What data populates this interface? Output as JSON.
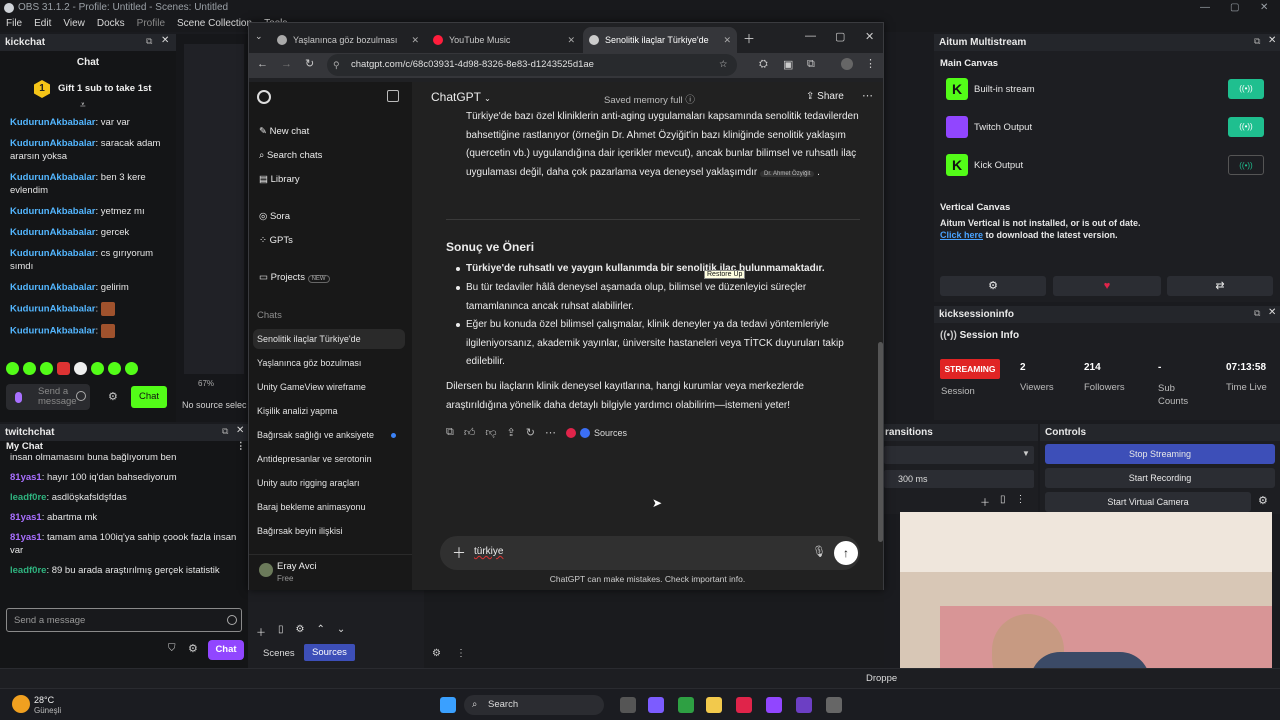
{
  "obs": {
    "title": "OBS 31.1.2 - Profile: Untitled - Scenes: Untitled",
    "menu": [
      "File",
      "Edit",
      "View",
      "Docks",
      "Profile",
      "Scene Collection",
      "Tools"
    ]
  },
  "kickchat": {
    "dock_title": "kickchat",
    "header": "Chat",
    "gift_banner": "Gift 1 sub to take 1st",
    "messages": [
      {
        "user": "KudurunAkbabalar",
        "text": "var var"
      },
      {
        "user": "KudurunAkbabalar",
        "text": "saracak adam ararsın yoksa"
      },
      {
        "user": "KudurunAkbabalar",
        "text": "ben 3 kere evlendim"
      },
      {
        "user": "KudurunAkbabalar",
        "text": "yetmez mı"
      },
      {
        "user": "KudurunAkbabalar",
        "text": "gercek"
      },
      {
        "user": "KudurunAkbabalar",
        "text": "cs gırıyorum sımdı"
      },
      {
        "user": "KudurunAkbabalar",
        "text": "gelirim"
      },
      {
        "user": "KudurunAkbabalar",
        "text": ""
      },
      {
        "user": "KudurunAkbabalar",
        "text": ""
      }
    ],
    "input_placeholder": "Send a message",
    "send_label": "Chat",
    "side_text": "No source selec"
  },
  "browser": {
    "tabs": [
      {
        "label": "Yaşlanınca göz bozulması",
        "icon_color": "#aaaaaa"
      },
      {
        "label": "YouTube Music",
        "icon_color": "#ff1d3c"
      },
      {
        "label": "Senolitik ilaçlar Türkiye'de",
        "icon_color": "#cccccc"
      }
    ],
    "url": "chatgpt.com/c/68c03931-4d98-8326-8e83-d1243525d1ae"
  },
  "chatgpt": {
    "sidebar": {
      "new_chat": "New chat",
      "search": "Search chats",
      "library": "Library",
      "sora": "Sora",
      "gpts": "GPTs",
      "projects": "Projects",
      "projects_badge": "NEW",
      "chats_heading": "Chats",
      "chats": [
        "Senolitik ilaçlar Türkiye'de",
        "Yaşlanınca göz bozulması",
        "Unity GameView wireframe",
        "Kişilik analizi yapma",
        "Bağırsak sağlığı ve anksiyete",
        "Antidepresanlar ve serotonin",
        "Unity auto rigging araçları",
        "Baraj bekleme animasyonu",
        "Bağırsak beyin ilişkisi"
      ],
      "user_name": "Eray Avci",
      "user_plan": "Free"
    },
    "header": {
      "model": "ChatGPT",
      "memory": "Saved memory full",
      "share": "Share"
    },
    "body": {
      "para1": "Türkiye'de bazı özel kliniklerin anti-aging uygulamaları kapsamında senolitik tedavilerden bahsettiğine rastlanıyor (örneğin Dr. Ahmet Özyiğit'in bazı kliniğinde senolitik yaklaşım (quercetin vb.) uygulandığına dair içerikler mevcut), ancak bunlar bilimsel ve ruhsatlı ilaç uygulaması değil, daha çok pazarlama veya deneysel yaklaşımdır",
      "para1_cite": "Dr. Ahmet Özyiğit",
      "heading": "Sonuç ve Öneri",
      "bullets": [
        "Türkiye'de ruhsatlı ve yaygın kullanımda bir senolitik ilaç bulunmamaktadır.",
        "Bu tür tedaviler hâlâ deneysel aşamada olup, bilimsel ve düzenleyici süreçler tamamlanınca ancak ruhsat alabilirler.",
        "Eğer bu konuda özel bilimsel çalışmalar, klinik deneyler ya da tedavi yöntemleriyle ilgileniyorsanız, akademik yayınlar, üniversite hastaneleri veya TİTCK duyuruları takip edilebilir."
      ],
      "tooltip": "Restore Up",
      "closing": "Dilersen bu ilaçların klinik deneysel kayıtlarına, hangi kurumlar veya merkezlerde araştırıldığına yönelik daha detaylı bilgiyle yardımcı olabilirim—istemeni yeter!",
      "sources": "Sources"
    },
    "composer_text": "türkiye",
    "disclaimer": "ChatGPT can make mistakes. Check important info."
  },
  "twitchchat": {
    "dock_title": "twitchchat",
    "header": "My Chat",
    "messages": [
      {
        "user": "",
        "text": "insan olmamasını buna bağlıyorum ben",
        "color": "#e6e6e6"
      },
      {
        "user": "81yas1",
        "text": "hayır 100 iq'dan bahsediyorum",
        "color": "#a970ff"
      },
      {
        "user": "leadf0re",
        "text": "asdlöşkafsldşfdas",
        "color": "#2fb37f"
      },
      {
        "user": "81yas1",
        "text": "abartma mk",
        "color": "#a970ff"
      },
      {
        "user": "81yas1",
        "text": "tamam ama 100iq'ya sahip çoook fazla insan var",
        "color": "#a970ff"
      },
      {
        "user": "leadf0re",
        "text": "89 bu arada araştırılmış gerçek istatistik",
        "color": "#2fb37f"
      }
    ],
    "input_placeholder": "Send a message",
    "chat_button": "Chat"
  },
  "scenes": {
    "tabs": [
      "Scenes",
      "Sources"
    ],
    "transitions_title": "ransitions",
    "duration": "300 ms",
    "zoom": "67%"
  },
  "aitum": {
    "title": "Aitum Multistream",
    "main_canvas": "Main Canvas",
    "outputs": [
      {
        "name": "Built-in stream",
        "logo_color": "#53fc18",
        "active": true
      },
      {
        "name": "Twitch Output",
        "logo_color": "#9146ff",
        "active": true
      },
      {
        "name": "Kick Output",
        "logo_color": "#53fc18",
        "active": false
      }
    ],
    "vertical_canvas": "Vertical Canvas",
    "vertical_warning": "Aitum Vertical is not installed, or is out of date.",
    "click_here": "Click here",
    "download_text": "to download the latest version."
  },
  "kicksession": {
    "title": "kicksessioninfo",
    "section": "Session Info",
    "status": "STREAMING",
    "session_label": "Session",
    "viewers": "2",
    "viewers_label": "Viewers",
    "followers": "214",
    "followers_label": "Followers",
    "subs": "-",
    "subs_label": "Sub Counts",
    "time": "07:13:58",
    "time_label": "Time Live"
  },
  "controls": {
    "title": "Controls",
    "stop_streaming": "Stop Streaming",
    "start_recording": "Start Recording",
    "start_virtual_camera": "Start Virtual Camera"
  },
  "statusbar": {
    "dropped": "Droppe"
  },
  "taskbar": {
    "temperature": "28°C",
    "weather": "Güneşli",
    "search": "Search"
  }
}
